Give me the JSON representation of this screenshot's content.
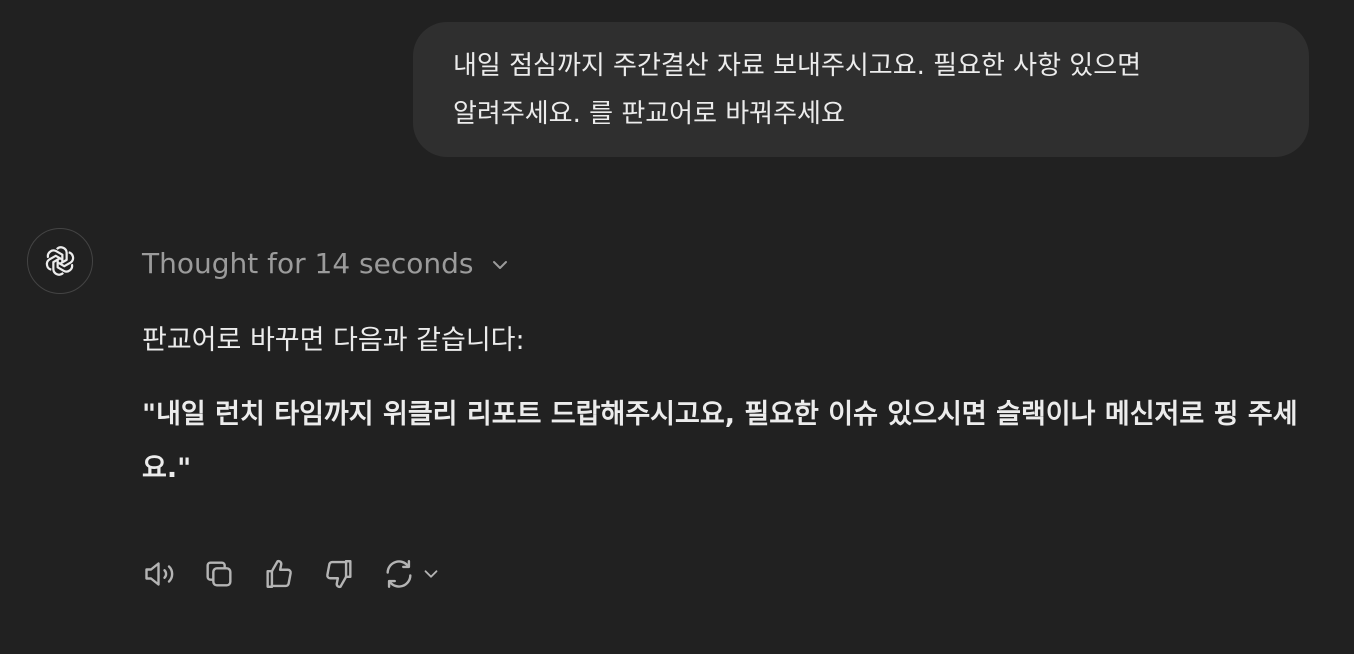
{
  "user_message": {
    "text": "내일 점심까지 주간결산 자료 보내주시고요. 필요한 사항 있으면\n알려주세요. 를 판교어로 바꿔주세요"
  },
  "assistant": {
    "thought_label": "Thought for 14 seconds",
    "intro": "판교어로 바꾸면 다음과 같습니다:",
    "quote": "\"내일 런치 타임까지 위클리 리포트 드랍해주시고요, 필요한 이슈 있으시면 슬랙이나 메신저로 핑 주세요.\""
  },
  "actions": {
    "icons": [
      "speaker-icon",
      "copy-icon",
      "thumbs-up-icon",
      "thumbs-down-icon",
      "regenerate-icon",
      "chevron-down-icon"
    ]
  },
  "colors": {
    "background": "#212121",
    "bubble": "#2f2f2f",
    "text": "#ececec",
    "muted": "#9b9b9b"
  }
}
